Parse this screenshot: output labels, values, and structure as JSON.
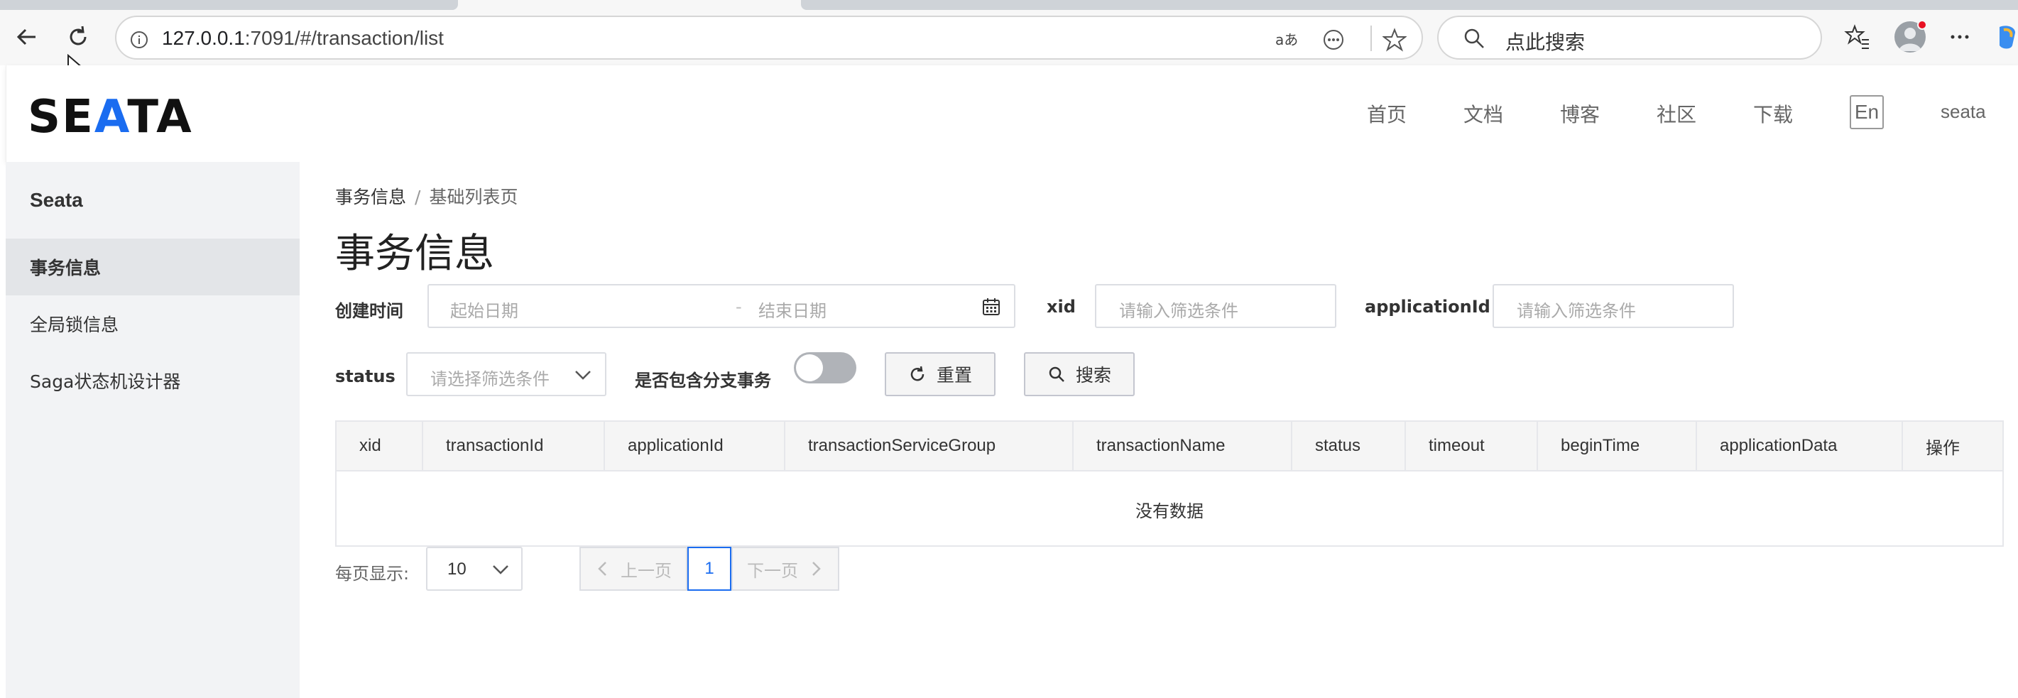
{
  "browser": {
    "url_host": "127.0.0.1",
    "url_path": ":7091/#/transaction/list",
    "search_placeholder": "点此搜索"
  },
  "header": {
    "logo_a": "SE",
    "logo_b": "A",
    "logo_c": "TA",
    "nav": [
      "首页",
      "文档",
      "博客",
      "社区",
      "下载"
    ],
    "lang": "En",
    "user": "seata"
  },
  "sidebar": {
    "title": "Seata",
    "items": [
      {
        "label": "事务信息"
      },
      {
        "label": "全局锁信息"
      },
      {
        "label": "Saga状态机设计器"
      }
    ]
  },
  "breadcrumb": {
    "parent": "事务信息",
    "separator": "/",
    "current": "基础列表页"
  },
  "page": {
    "title": "事务信息"
  },
  "filters": {
    "created_time_label": "创建时间",
    "start_date_placeholder": "起始日期",
    "range_separator": "-",
    "end_date_placeholder": "结束日期",
    "xid_label": "xid",
    "xid_placeholder": "请输入筛选条件",
    "application_id_label": "applicationId",
    "application_id_placeholder": "请输入筛选条件",
    "status_label": "status",
    "status_placeholder": "请选择筛选条件",
    "include_branch_label": "是否包含分支事务",
    "include_branch_on": false,
    "reset_label": "重置",
    "search_label": "搜索"
  },
  "table": {
    "columns": [
      "xid",
      "transactionId",
      "applicationId",
      "transactionServiceGroup",
      "transactionName",
      "status",
      "timeout",
      "beginTime",
      "applicationData",
      "操作"
    ],
    "empty_text": "没有数据"
  },
  "pagination": {
    "page_size_label": "每页显示:",
    "page_size": "10",
    "prev_label": "上一页",
    "current_page": "1",
    "next_label": "下一页"
  },
  "colors": {
    "accent": "#1a6cf0",
    "sidebar_bg": "#f2f3f5",
    "toggle_off": "#b0b3b8"
  }
}
